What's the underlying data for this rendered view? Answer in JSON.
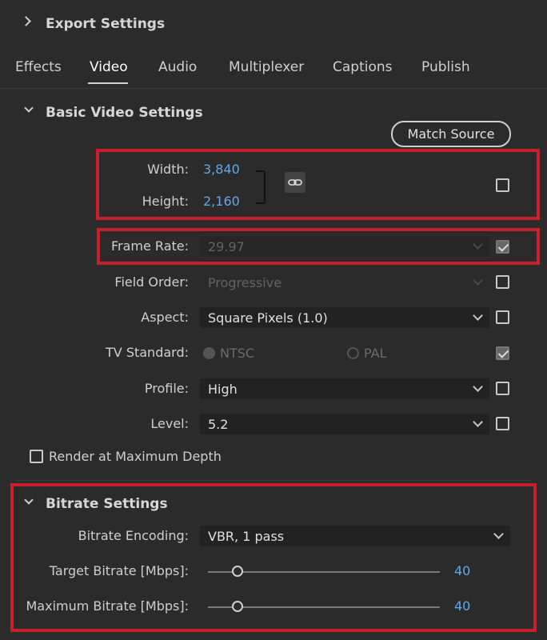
{
  "header": {
    "title": "Export Settings"
  },
  "tabs": [
    {
      "label": "Effects"
    },
    {
      "label": "Video"
    },
    {
      "label": "Audio"
    },
    {
      "label": "Multiplexer"
    },
    {
      "label": "Captions"
    },
    {
      "label": "Publish"
    }
  ],
  "active_tab": "Video",
  "basic": {
    "title": "Basic Video Settings",
    "match_source": "Match Source",
    "width_label": "Width:",
    "width_value": "3,840",
    "height_label": "Height:",
    "height_value": "2,160",
    "frame_rate_label": "Frame Rate:",
    "frame_rate_value": "29.97",
    "field_order_label": "Field Order:",
    "field_order_value": "Progressive",
    "aspect_label": "Aspect:",
    "aspect_value": "Square Pixels (1.0)",
    "tv_standard_label": "TV Standard:",
    "ntsc_label": "NTSC",
    "pal_label": "PAL",
    "profile_label": "Profile:",
    "profile_value": "High",
    "level_label": "Level:",
    "level_value": "5.2",
    "render_max_depth": "Render at Maximum Depth"
  },
  "bitrate": {
    "title": "Bitrate Settings",
    "encoding_label": "Bitrate Encoding:",
    "encoding_value": "VBR, 1 pass",
    "target_label": "Target Bitrate [Mbps]:",
    "target_value": "40",
    "max_label": "Maximum Bitrate [Mbps]:",
    "max_value": "40"
  },
  "colors": {
    "accent_red": "#c8202a",
    "value_blue": "#62a9e8"
  }
}
